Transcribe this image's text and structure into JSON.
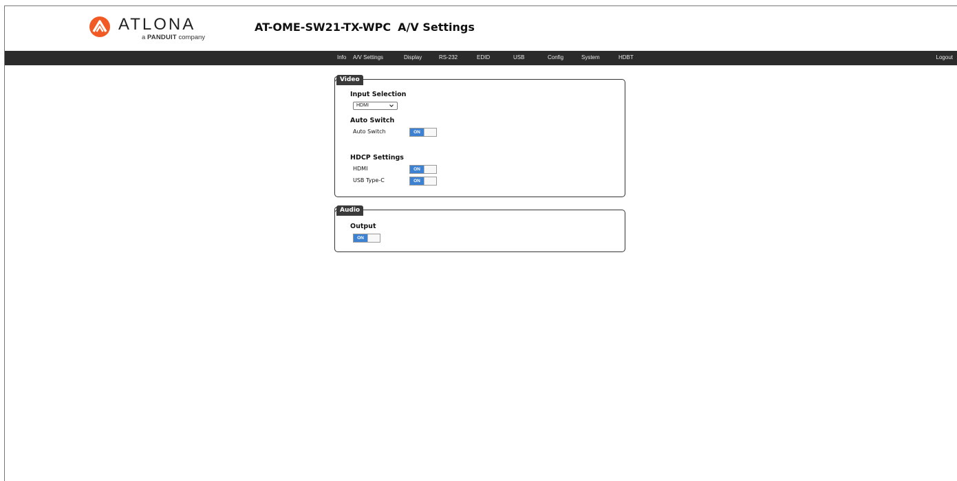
{
  "header": {
    "brand": "ATLONA",
    "tagline_prefix": "a",
    "tagline_brand": "PANDUIT",
    "tagline_suffix": "company",
    "device_model": "AT-OME-SW21-TX-WPC",
    "page_name": "A/V Settings"
  },
  "colors": {
    "logo_orange": "#f15a24",
    "navbar_bg": "#2b2b2b",
    "toggle_on": "#3d82d2"
  },
  "nav": {
    "items": [
      "Info",
      "A/V Settings",
      "Display",
      "RS-232",
      "EDID",
      "USB",
      "Config",
      "System",
      "HDBT"
    ],
    "logout": "Logout"
  },
  "video": {
    "legend": "Video",
    "input_selection": {
      "heading": "Input Selection",
      "selected": "HDMI"
    },
    "auto_switch": {
      "heading": "Auto Switch",
      "label": "Auto Switch",
      "state": "ON"
    },
    "hdcp": {
      "heading": "HDCP Settings",
      "hdmi_label": "HDMI",
      "hdmi_state": "ON",
      "usbc_label": "USB Type-C",
      "usbc_state": "ON"
    }
  },
  "audio": {
    "legend": "Audio",
    "output": {
      "heading": "Output",
      "state": "ON"
    }
  }
}
